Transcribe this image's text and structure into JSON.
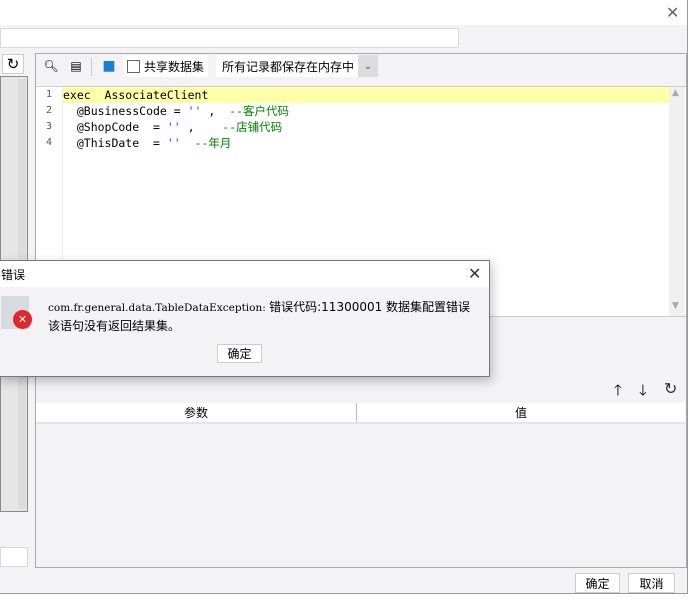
{
  "window": {
    "close_icon": "close-icon"
  },
  "toolbar": {
    "share_label": "共享数据集",
    "share_checked": false,
    "storage_select": "所有记录都保存在内存中"
  },
  "editor": {
    "lines": [
      {
        "n": "1",
        "parts": [
          [
            "kw",
            "exec  AssociateClient"
          ]
        ]
      },
      {
        "n": "2",
        "parts": [
          [
            "kw",
            "  @BusinessCode = "
          ],
          [
            "str",
            "''"
          ],
          [
            "kw",
            " ,  "
          ],
          [
            "cm",
            "--客户代码"
          ]
        ]
      },
      {
        "n": "3",
        "parts": [
          [
            "kw",
            "  @ShopCode  = "
          ],
          [
            "str",
            "''"
          ],
          [
            "kw",
            " ,    "
          ],
          [
            "cm",
            "--店铺代码"
          ]
        ]
      },
      {
        "n": "4",
        "parts": [
          [
            "kw",
            "  @ThisDate  = "
          ],
          [
            "str",
            "''"
          ],
          [
            "kw",
            "  "
          ],
          [
            "cm",
            "--年月"
          ]
        ]
      }
    ]
  },
  "params": {
    "columns": [
      "参数",
      "值"
    ]
  },
  "footer": {
    "ok": "确定",
    "cancel": "取消"
  },
  "dialog": {
    "title": "错误",
    "message_line1_code": "com.fr.general.data.TableDataException: ",
    "message_line1_text": "错误代码:11300001 数据集配置错误",
    "message_line2": "该语句没有返回结果集。",
    "ok": "确定"
  },
  "colors": {
    "highlight_line": "#ffffa8",
    "error_red": "#e3262d",
    "comment": "#008000",
    "string": "#e0007a"
  }
}
